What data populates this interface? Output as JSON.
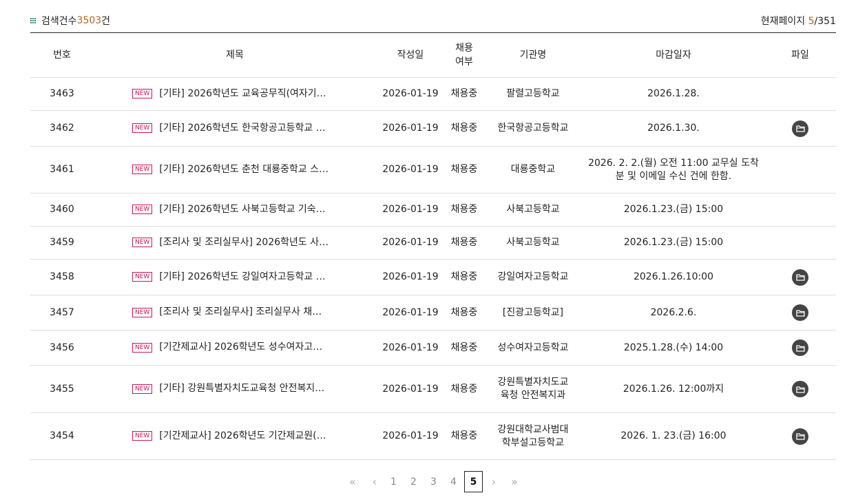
{
  "summary": {
    "count_prefix": "검색건수 ",
    "count_value": "3503",
    "count_suffix": "건",
    "page_prefix": "현재페이지 ",
    "page_current": "5",
    "page_sep_total": "/351"
  },
  "columns": [
    "번호",
    "제목",
    "작성일",
    "채용\n여부",
    "기관명",
    "마감일자",
    "파일"
  ],
  "new_badge": "NEW",
  "rows": [
    {
      "no": "3463",
      "title": "[기타] 2026학년도 교육공무직(여자기…",
      "date": "2026-01-19",
      "status": "채용중",
      "org": "팔렬고등학교",
      "deadline": "2026.1.28.",
      "file": false
    },
    {
      "no": "3462",
      "title": "[기타] 2026학년도 한국항공고등학교 …",
      "date": "2026-01-19",
      "status": "채용중",
      "org": "한국항공고등학교",
      "deadline": "2026.1.30.",
      "file": true
    },
    {
      "no": "3461",
      "title": "[기타] 2026학년도 춘천 대룡중학교 스…",
      "date": "2026-01-19",
      "status": "채용중",
      "org": "대룡중학교",
      "deadline": "2026. 2. 2.(월) 오전 11:00 교무실 도착\n분 및 이메일 수신 건에 한함.",
      "file": false
    },
    {
      "no": "3460",
      "title": "[기타] 2026학년도 사북고등학교 기숙…",
      "date": "2026-01-19",
      "status": "채용중",
      "org": "사북고등학교",
      "deadline": "2026.1.23.(금) 15:00",
      "file": false
    },
    {
      "no": "3459",
      "title": "[조리사 및 조리실무사] 2026학년도 사…",
      "date": "2026-01-19",
      "status": "채용중",
      "org": "사북고등학교",
      "deadline": "2026.1.23.(금) 15:00",
      "file": false
    },
    {
      "no": "3458",
      "title": "[기타] 2026학년도 강일여자고등학교 …",
      "date": "2026-01-19",
      "status": "채용중",
      "org": "강일여자고등학교",
      "deadline": "2026.1.26.10:00",
      "file": true
    },
    {
      "no": "3457",
      "title": "[조리사 및 조리실무사] 조리실무사 채…",
      "date": "2026-01-19",
      "status": "채용중",
      "org": "[진광고등학교]",
      "deadline": "2026.2.6.",
      "file": true
    },
    {
      "no": "3456",
      "title": "[기간제교사] 2026학년도 성수여자고…",
      "date": "2026-01-19",
      "status": "채용중",
      "org": "성수여자고등학교",
      "deadline": "2025.1.28.(수) 14:00",
      "file": true
    },
    {
      "no": "3455",
      "title": "[기타] 강원특별자치도교육청 안전복지…",
      "date": "2026-01-19",
      "status": "채용중",
      "org": "강원특별자치도교\n육청 안전복지과",
      "deadline": "2026.1.26. 12:00까지",
      "file": true
    },
    {
      "no": "3454",
      "title": "[기간제교사] 2026학년도 기간제교원(…",
      "date": "2026-01-19",
      "status": "채용중",
      "org": "강원대학교사범대\n학부설고등학교",
      "deadline": "2026. 1. 23.(금) 16:00",
      "file": true
    }
  ],
  "pagination": {
    "first": "«",
    "prev": "‹",
    "pages": [
      "1",
      "2",
      "3",
      "4",
      "5"
    ],
    "current": "5",
    "next": "›",
    "last": "»"
  }
}
